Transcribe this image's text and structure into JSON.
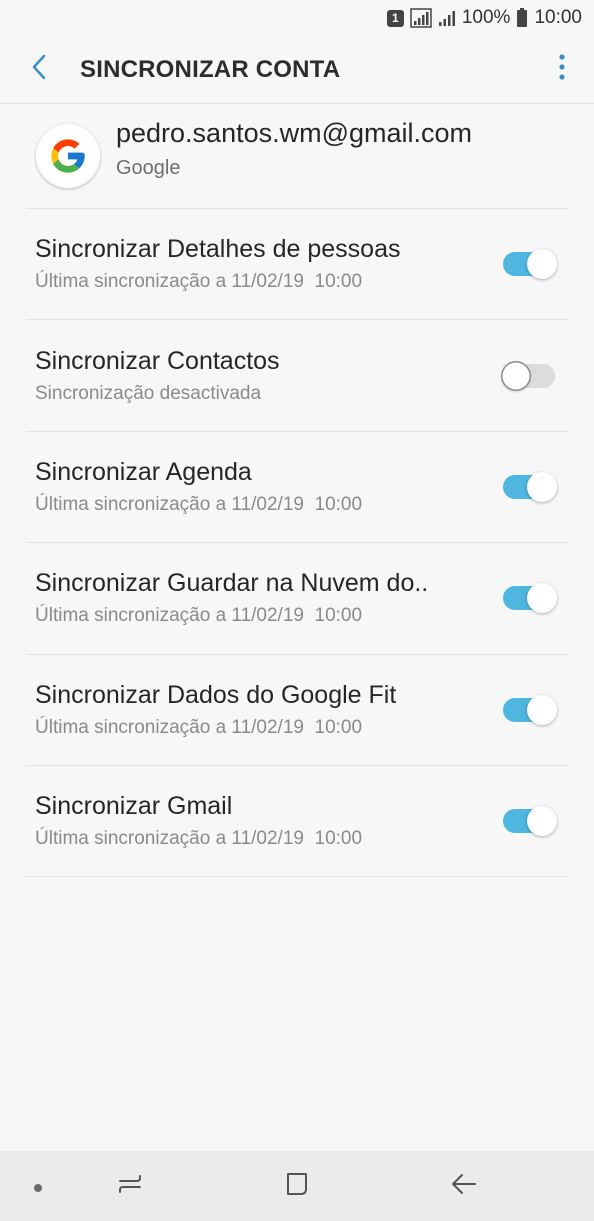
{
  "status_bar": {
    "sim_label": "1",
    "battery_percent": "100%",
    "time": "10:00"
  },
  "header": {
    "title": "SINCRONIZAR CONTA",
    "back_icon": "chevron-left-icon",
    "more_icon": "more-vertical-icon",
    "accent_color": "#3a8fbf"
  },
  "account": {
    "email": "pedro.santos.wm@gmail.com",
    "type": "Google",
    "logo_icon": "google-logo-icon"
  },
  "sync_items": [
    {
      "title": "Sincronizar Detalhes de pessoas",
      "subtitle": "Última sincronização a 11/02/19  10:00",
      "enabled": true
    },
    {
      "title": "Sincronizar Contactos",
      "subtitle": "Sincronização desactivada",
      "enabled": false
    },
    {
      "title": "Sincronizar Agenda",
      "subtitle": "Última sincronização a 11/02/19  10:00",
      "enabled": true
    },
    {
      "title": "Sincronizar Guardar na Nuvem do..",
      "subtitle": "Última sincronização a 11/02/19  10:00",
      "enabled": true
    },
    {
      "title": "Sincronizar Dados do Google Fit",
      "subtitle": "Última sincronização a 11/02/19  10:00",
      "enabled": true
    },
    {
      "title": "Sincronizar Gmail",
      "subtitle": "Última sincronização a 11/02/19  10:00",
      "enabled": true
    }
  ],
  "toggle_colors": {
    "on": "#4fb6e0",
    "off": "#dcdcdc"
  },
  "nav_bar": {
    "icons": [
      "dot-icon",
      "recent-apps-icon",
      "home-icon",
      "back-arrow-icon"
    ]
  }
}
